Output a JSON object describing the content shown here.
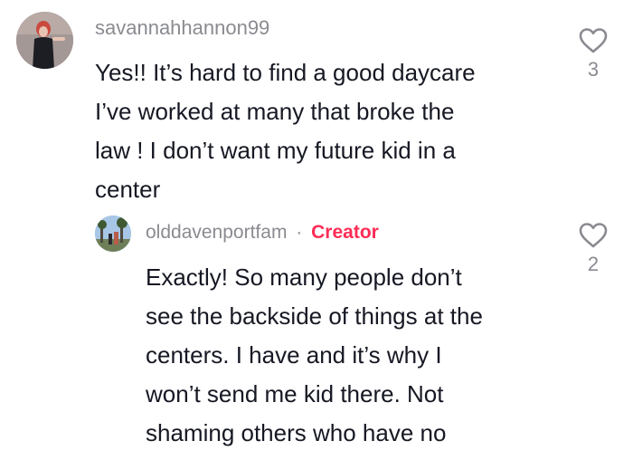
{
  "comments": [
    {
      "username": "savannahhannon99",
      "lines": [
        "Yes!! It’s hard to find a good daycare",
        "I’ve worked at many that broke the",
        "law ! I don’t want my future kid in a",
        "center"
      ],
      "likes": "3",
      "icons": {
        "avatar": "user-avatar",
        "like": "heart-outline-icon"
      }
    },
    {
      "username": "olddavenportfam",
      "badge_separator": "·",
      "badge": "Creator",
      "lines": [
        "Exactly! So many people don’t",
        "see the backside of things at the",
        "centers. I have and it’s why I",
        "won’t send me kid there. Not",
        "shaming others who have no"
      ],
      "likes": "2",
      "icons": {
        "avatar": "user-avatar",
        "like": "heart-outline-icon"
      }
    }
  ],
  "colors": {
    "username": "#8a8b91",
    "text": "#161823",
    "creator": "#fe2c55",
    "icon": "#8a8b91"
  }
}
